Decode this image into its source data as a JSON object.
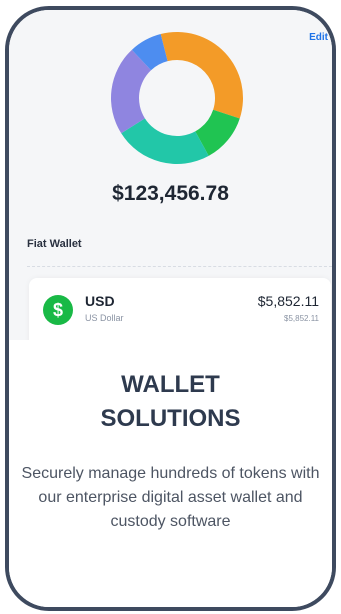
{
  "header": {
    "edit_label": "Edit"
  },
  "portfolio": {
    "total_balance": "$123,456.78",
    "allocation_colors": [
      "#f39b28",
      "#20c452",
      "#22c7a8",
      "#8f85e0",
      "#4d8df0"
    ],
    "allocation_shares": [
      0.34,
      0.12,
      0.24,
      0.22,
      0.08
    ]
  },
  "fiat_wallet": {
    "title": "Fiat Wallet",
    "items": [
      {
        "icon": "dollar-icon",
        "code": "USD",
        "name": "US Dollar",
        "amount": "$5,852.11",
        "fiat_value": "$5,852.11",
        "icon_color": "#19b946"
      }
    ]
  },
  "promo": {
    "headline_line1": "WALLET",
    "headline_line2": "SOLUTIONS",
    "description": "Securely manage hundreds of tokens with our enterprise digital asset wallet and custody software"
  }
}
